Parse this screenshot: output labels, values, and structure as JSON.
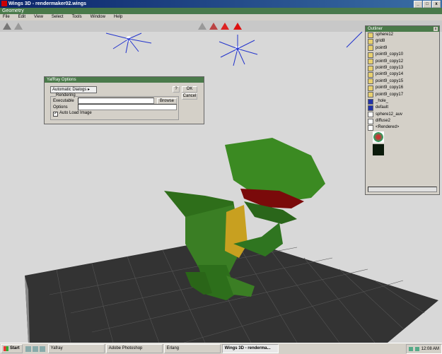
{
  "window": {
    "title": "Wings 3D - rendermaker02.wings",
    "min": "_",
    "max": "□",
    "close": "x"
  },
  "geometry_bar": "Geometry",
  "menu": [
    "File",
    "Edit",
    "View",
    "Select",
    "Tools",
    "Window",
    "Help"
  ],
  "dialog": {
    "title": "YafRay Options",
    "dropdown": "Automatic Dialogs ▸",
    "help": "?",
    "ok": "OK",
    "cancel": "Cancel",
    "group": "Rendering",
    "executable_label": "Executable",
    "executable_value": "",
    "browse": "Browse",
    "options_label": "Options",
    "options_value": "",
    "auto_load": "Auto Load Image",
    "auto_load_checked": true
  },
  "outliner": {
    "title": "Outliner",
    "close": "x",
    "items": [
      {
        "label": "sphere12",
        "icon": "light-icon"
      },
      {
        "label": "grid8",
        "icon": "light-icon"
      },
      {
        "label": "point9",
        "icon": "light-icon"
      },
      {
        "label": "point9_copy10",
        "icon": "light-icon"
      },
      {
        "label": "point9_copy12",
        "icon": "light-icon"
      },
      {
        "label": "point9_copy13",
        "icon": "light-icon"
      },
      {
        "label": "point9_copy14",
        "icon": "light-icon"
      },
      {
        "label": "point9_copy15",
        "icon": "light-icon"
      },
      {
        "label": "point9_copy16",
        "icon": "light-icon"
      },
      {
        "label": "point9_copy17",
        "icon": "light-icon"
      },
      {
        "label": "_hole_",
        "icon": "material-icon"
      },
      {
        "label": "default",
        "icon": "material-icon"
      },
      {
        "label": "sphere12_auv",
        "icon": "image-icon"
      },
      {
        "label": "diffuse2",
        "icon": "image-icon"
      },
      {
        "label": "<Rendered>",
        "icon": "image-icon"
      }
    ]
  },
  "taskbar": {
    "start": "Start",
    "tasks": [
      "Yafray",
      "Adobe Photoshop",
      "Erlang",
      "Wings 3D - renderma..."
    ],
    "active_task": 3,
    "clock": "12:08 AM"
  },
  "colors": {
    "title_bar": "#0a246a",
    "panel_title": "#4a7a4a",
    "viewport": "#d8d8d8",
    "dino": "#2e7d1e",
    "grid_floor": "#3a3a3a"
  }
}
